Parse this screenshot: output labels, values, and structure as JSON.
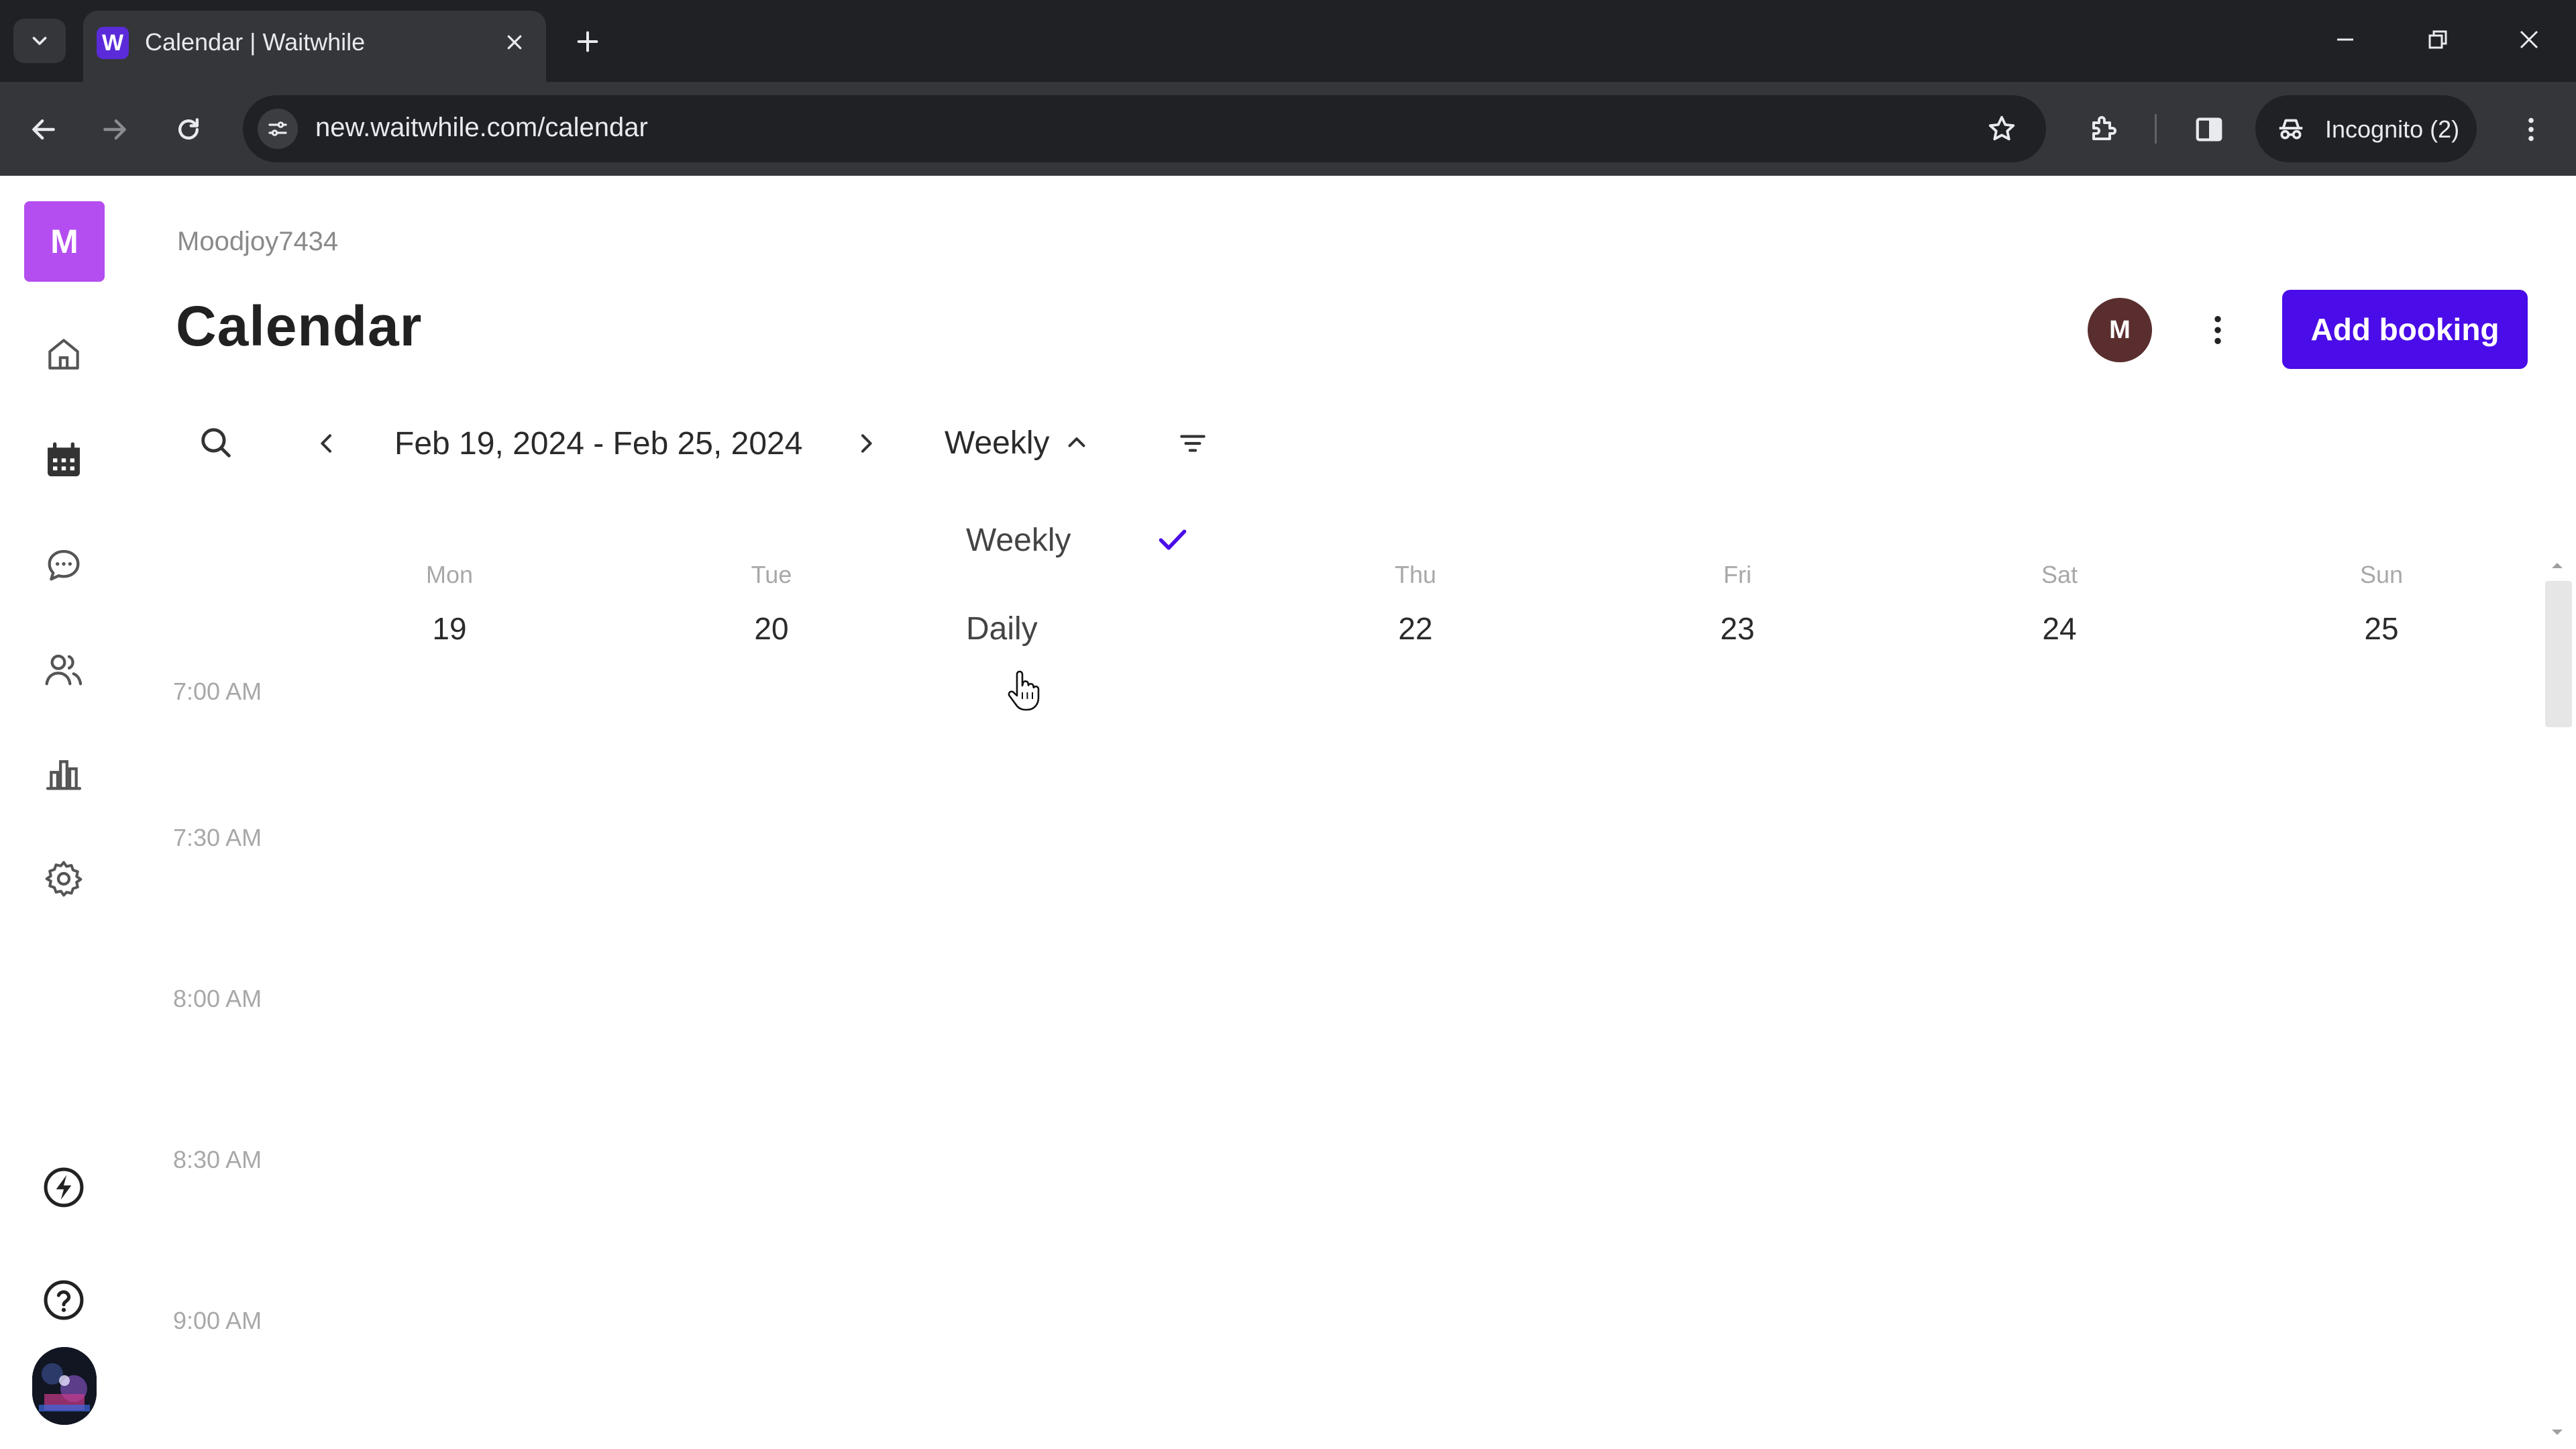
{
  "browser": {
    "tab": {
      "title": "Calendar | Waitwhile",
      "favicon_letter": "W"
    },
    "url": "new.waitwhile.com/calendar",
    "incognito_label": "Incognito (2)"
  },
  "sidebar": {
    "brand_letter": "M",
    "items": [
      {
        "icon": "home-icon"
      },
      {
        "icon": "calendar-icon",
        "active": true
      },
      {
        "icon": "chat-icon"
      },
      {
        "icon": "customers-icon"
      },
      {
        "icon": "analytics-icon"
      },
      {
        "icon": "settings-icon"
      },
      {
        "icon": "bolt-icon"
      },
      {
        "icon": "help-icon"
      }
    ]
  },
  "header": {
    "business_name": "Moodjoy7434",
    "title": "Calendar",
    "user_initial": "M",
    "add_booking_label": "Add booking"
  },
  "toolbar": {
    "date_range": "Feb 19, 2024 - Feb 25, 2024",
    "view_label": "Weekly"
  },
  "view_menu": {
    "options": [
      {
        "label": "Weekly",
        "selected": true
      },
      {
        "label": "Daily",
        "selected": false
      }
    ]
  },
  "calendar": {
    "days": [
      {
        "name": "Mon",
        "date": "19"
      },
      {
        "name": "Tue",
        "date": "20"
      },
      {
        "name": "Thu",
        "date": "22"
      },
      {
        "name": "Fri",
        "date": "23"
      },
      {
        "name": "Sat",
        "date": "24"
      },
      {
        "name": "Sun",
        "date": "25"
      }
    ],
    "times": [
      "7:00 AM",
      "7:30 AM",
      "8:00 AM",
      "8:30 AM",
      "9:00 AM"
    ]
  },
  "colors": {
    "accent": "#4a0ce8",
    "brand": "#b44ef0",
    "check": "#4a0ce8"
  }
}
